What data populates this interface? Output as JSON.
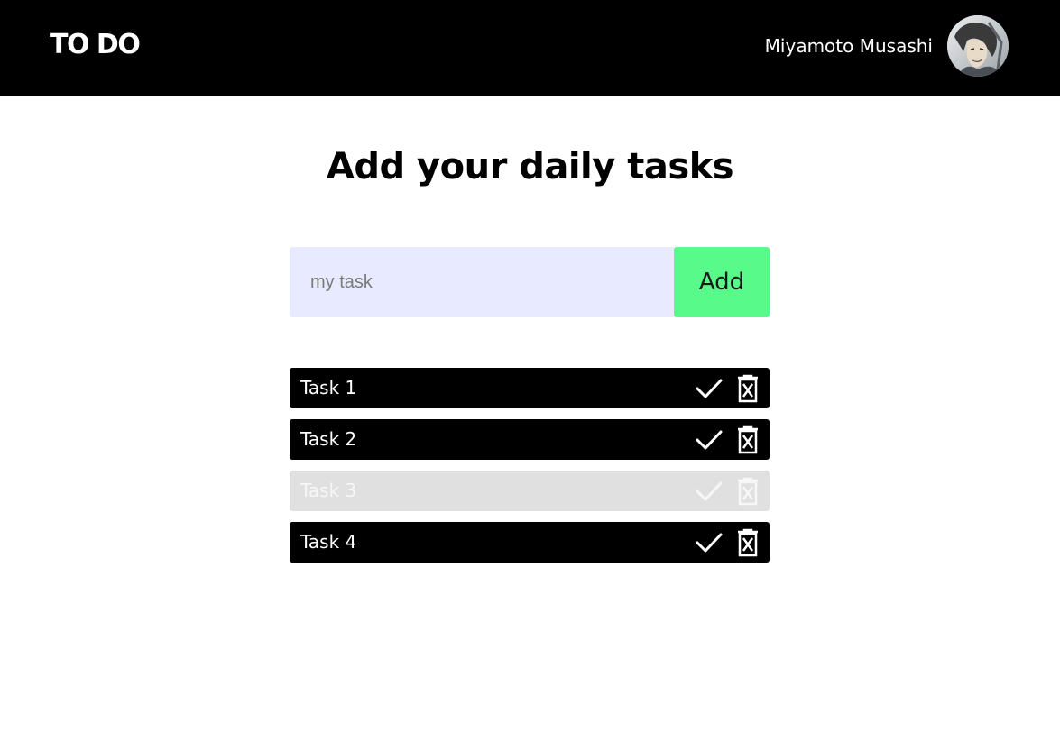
{
  "header": {
    "logo": "TO DO",
    "user_name": "Miyamoto Musashi"
  },
  "main": {
    "title": "Add your daily tasks",
    "input": {
      "value": "",
      "placeholder": "my task"
    },
    "add_label": "Add"
  },
  "tasks": [
    {
      "label": "Task 1",
      "completed": false
    },
    {
      "label": "Task 2",
      "completed": false
    },
    {
      "label": "Task 3",
      "completed": true
    },
    {
      "label": "Task 4",
      "completed": false
    }
  ],
  "icons": {
    "complete": "check-icon",
    "delete": "trash-x-icon"
  },
  "colors": {
    "header_bg": "#000000",
    "input_bg": "#e8ebff",
    "add_button_bg": "#58fa8a",
    "task_bg": "#000000",
    "task_done_bg": "#e0e0e0"
  }
}
